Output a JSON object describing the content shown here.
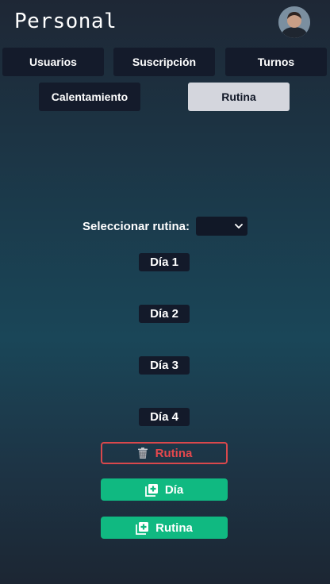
{
  "header": {
    "title": "Personal"
  },
  "nav": {
    "usuarios": "Usuarios",
    "suscripcion": "Suscripción",
    "turnos": "Turnos",
    "calentamiento": "Calentamiento",
    "rutina": "Rutina"
  },
  "routine_select": {
    "label": "Seleccionar rutina:",
    "value": ""
  },
  "days": [
    "Día 1",
    "Día 2",
    "Día 3",
    "Día 4"
  ],
  "actions": {
    "delete_routine": "Rutina",
    "add_day": "Día",
    "add_routine": "Rutina"
  },
  "colors": {
    "danger": "#e5484d",
    "success": "#10b981",
    "nav_bg": "#141b2b",
    "nav_active_bg": "#d4d6dd"
  }
}
